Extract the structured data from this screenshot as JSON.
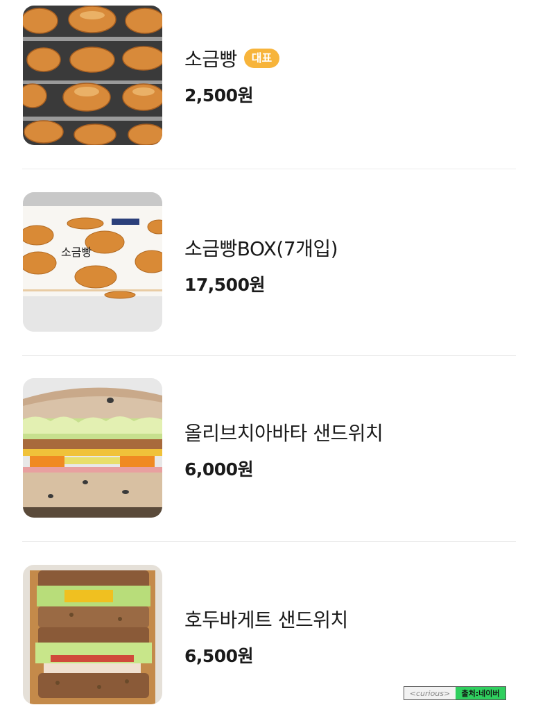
{
  "menu_items": [
    {
      "name": "소금빵",
      "badge": "대표",
      "price": "2,500원"
    },
    {
      "name": "소금빵BOX(7개입)",
      "badge": "",
      "price": "17,500원"
    },
    {
      "name": "올리브치아바타 샌드위치",
      "badge": "",
      "price": "6,000원"
    },
    {
      "name": "호두바게트 샌드위치",
      "badge": "",
      "price": "6,500원"
    }
  ],
  "box_label": "소금빵",
  "badge_color": "#f7b43b",
  "watermark": {
    "left_text": "<curious>",
    "right_text": "출처:네이버",
    "accent": "#2fcf5e"
  }
}
